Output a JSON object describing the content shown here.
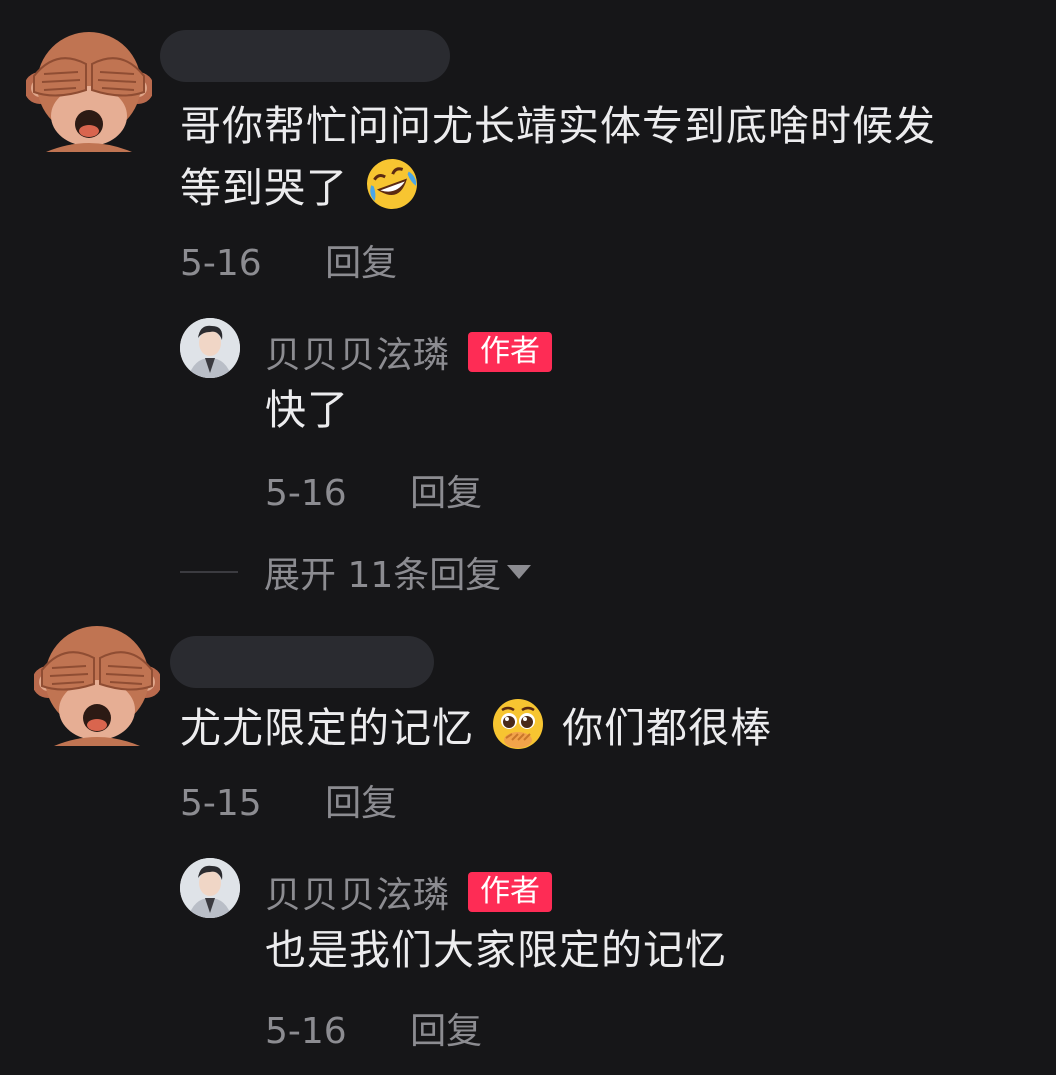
{
  "comments": [
    {
      "avatar_icon": "see-no-evil-monkey-icon",
      "text_line1": "哥你帮忙问问尤长靖实体专到底啥时候发",
      "text_line2": "等到哭了",
      "emoji": "rolling-on-floor-laughing-icon",
      "date": "5-16",
      "reply_label": "回复",
      "author_reply": {
        "avatar_icon": "author-avatar",
        "name": "贝贝贝泫璘",
        "badge": "作者",
        "text": "快了",
        "date": "5-16",
        "reply_label": "回复"
      },
      "expand_label": "展开 11条回复"
    },
    {
      "avatar_icon": "see-no-evil-monkey-icon",
      "text_before": "尤尤限定的记忆",
      "emoji": "pleading-face-icon",
      "text_after": "你们都很棒",
      "date": "5-15",
      "reply_label": "回复",
      "author_reply": {
        "avatar_icon": "author-avatar",
        "name": "贝贝贝泫璘",
        "badge": "作者",
        "text": "也是我们大家限定的记忆",
        "date": "5-16",
        "reply_label": "回复"
      }
    }
  ],
  "colors": {
    "background": "#161618",
    "badge": "#fe2c55",
    "meta_text": "#8c8c91"
  }
}
